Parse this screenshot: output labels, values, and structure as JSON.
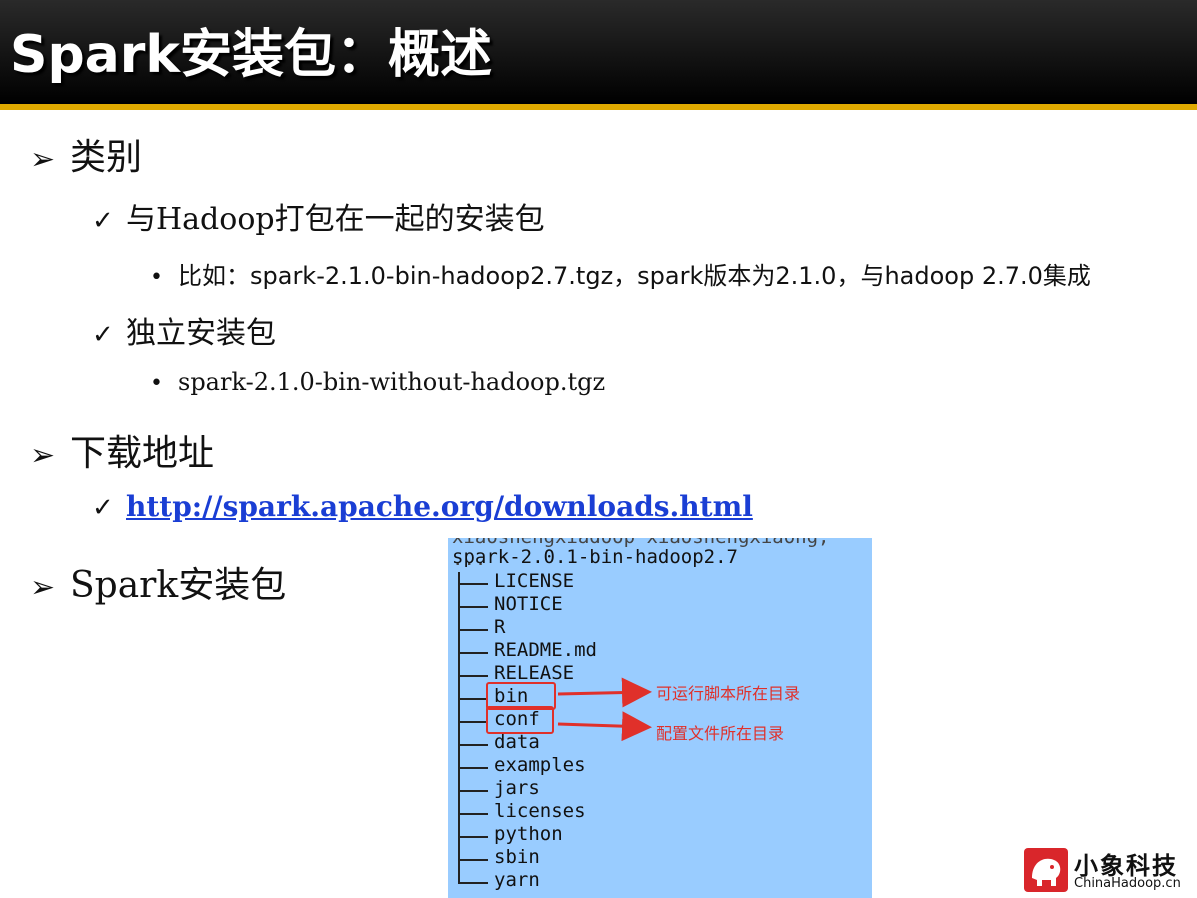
{
  "title": "Spark安装包：概述",
  "sections": [
    {
      "label": "类别",
      "items": [
        {
          "label": "与Hadoop打包在一起的安装包",
          "sub": [
            "比如：spark-2.1.0-bin-hadoop2.7.tgz，spark版本为2.1.0，与hadoop 2.7.0集成"
          ]
        },
        {
          "label": "独立安装包",
          "sub": [
            "spark-2.1.0-bin-without-hadoop.tgz"
          ]
        }
      ]
    },
    {
      "label": "下载地址",
      "items": [
        {
          "label": "http://spark.apache.org/downloads.html"
        }
      ]
    },
    {
      "label": "Spark安装包"
    }
  ],
  "terminal": {
    "cut_line": "xiaoshengxiadoop xiaoshengxiaong, ...",
    "root": "spark-2.0.1-bin-hadoop2.7",
    "entries": [
      "LICENSE",
      "NOTICE",
      "R",
      "README.md",
      "RELEASE",
      "bin",
      "conf",
      "data",
      "examples",
      "jars",
      "licenses",
      "python",
      "sbin",
      "yarn"
    ],
    "annotations": {
      "bin": "可运行脚本所在目录",
      "conf": "配置文件所在目录"
    },
    "highlight_color": "#e0302a",
    "background_color": "#99ccff"
  },
  "logo": {
    "name_cn": "小象科技",
    "name_en": "ChinaHadoop.cn",
    "icon": "elephant-logo-icon"
  },
  "colors": {
    "title_bar": "#000000",
    "title_rule": "#e0aa00",
    "link": "#1a3ed4"
  }
}
